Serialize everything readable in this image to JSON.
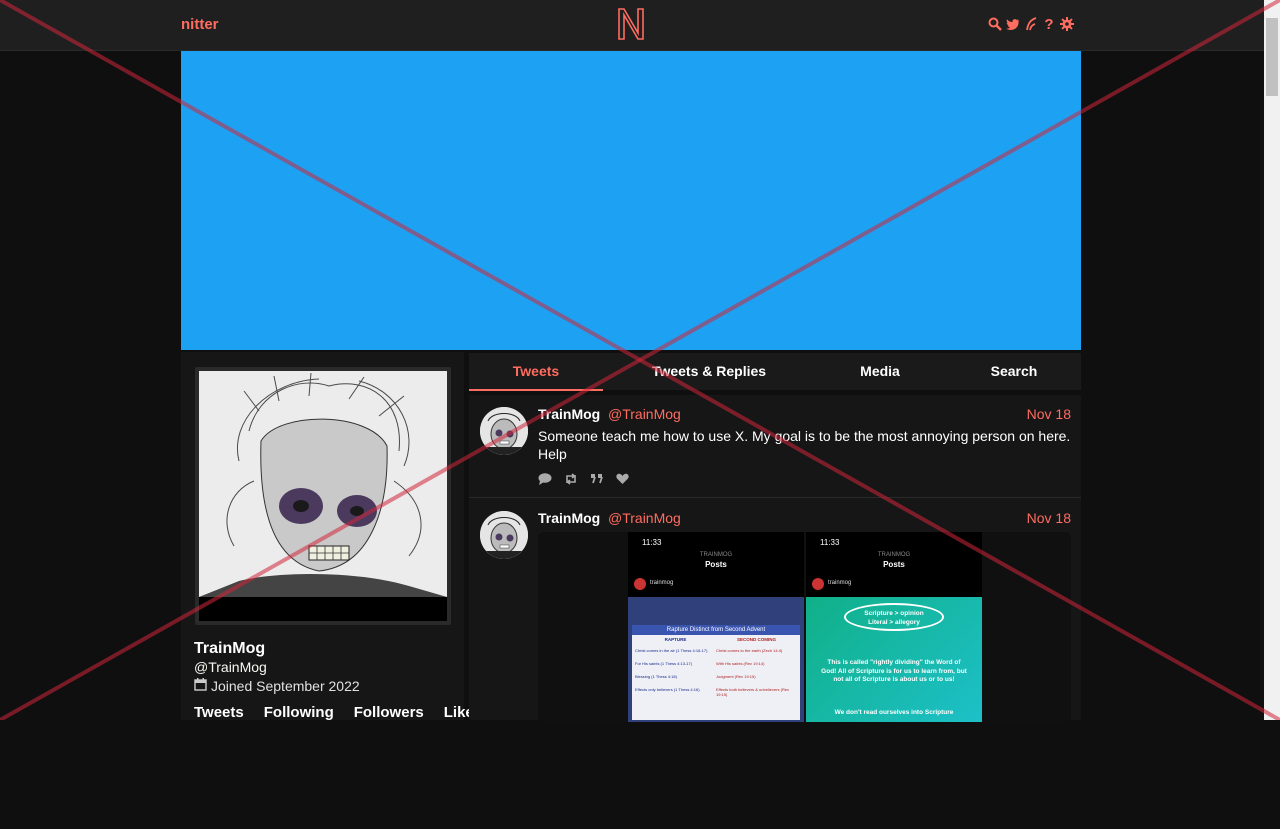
{
  "nav": {
    "brand": "nitter",
    "logo_letter": "N",
    "icons": [
      "search-icon",
      "bird-icon",
      "rss-icon",
      "help-icon",
      "gear-icon"
    ]
  },
  "colors": {
    "accent": "#ff6c60",
    "banner": "#1da1f2",
    "bg": "#0f0f0f",
    "panel": "#161616"
  },
  "profile": {
    "name": "TrainMog",
    "handle": "@TrainMog",
    "joined": "Joined September 2022",
    "stats": [
      "Tweets",
      "Following",
      "Followers",
      "Likes"
    ]
  },
  "tabs": [
    "Tweets",
    "Tweets & Replies",
    "Media",
    "Search"
  ],
  "tweets": [
    {
      "name": "TrainMog",
      "handle": "@TrainMog",
      "date": "Nov 18",
      "text": "Someone teach me how to use X. My goal is to be the most annoying person on here. Help"
    },
    {
      "name": "TrainMog",
      "handle": "@TrainMog",
      "date": "Nov 18",
      "images": [
        {
          "time": "11:33",
          "header_small": "TRAINMOG",
          "header": "Posts",
          "account": "trainmog",
          "title": "Rapture Distinct from Second Advent",
          "col1": "RAPTURE",
          "col2": "SECOND COMING",
          "rows": [
            [
              "Christ comes in the air (1 Thess 4:16-17)",
              "Christ comes to the earth (Zech 14:4)"
            ],
            [
              "For His saints (1 Thess 4:13-17)",
              "With His saints (Rev 19:14)"
            ],
            [
              "Blessing (1 Thess 4:18)",
              "Judgment (Rev 19:15)"
            ],
            [
              "Effects only believers (1 Thess 4:16)",
              "Effects both believers & unbelievers (Rev 19:15)"
            ]
          ]
        },
        {
          "time": "11:33",
          "header_small": "TRAINMOG",
          "header": "Posts",
          "account": "trainmog",
          "bubble_line1": "Scripture > opinion",
          "bubble_line2": "Literal > allegory",
          "body": "This is called \"rightly dividing\" the Word of God! All of Scripture is for us to learn from, but not all of Scripture is about us or to us!",
          "footer": "We don't read ourselves into Scripture"
        }
      ]
    }
  ]
}
